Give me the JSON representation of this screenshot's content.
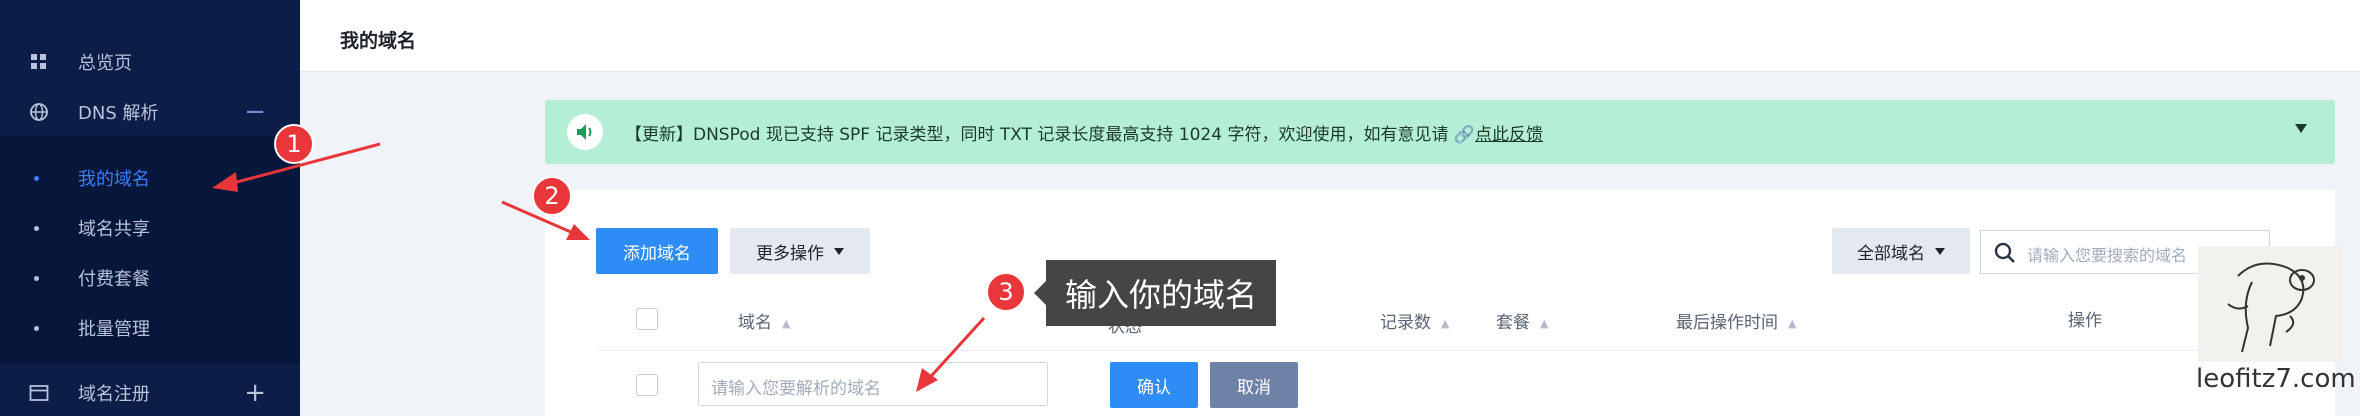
{
  "sidebar": {
    "items": [
      {
        "label": "总览页",
        "icon": "grid-icon"
      },
      {
        "label": "DNS 解析",
        "icon": "globe-icon",
        "toggle": "−"
      },
      {
        "label": "域名注册",
        "icon": "card-icon",
        "toggle": "+"
      }
    ],
    "dns_sub": [
      {
        "label": "我的域名",
        "active": true
      },
      {
        "label": "域名共享"
      },
      {
        "label": "付费套餐"
      },
      {
        "label": "批量管理"
      }
    ]
  },
  "header": {
    "title": "我的域名"
  },
  "notice": {
    "text": "【更新】DNSPod 现已支持 SPF 记录类型，同时 TXT 记录长度最高支持 1024 字符，欢迎使用，如有意见请 ",
    "link": "点此反馈",
    "bg": "#b4eed5"
  },
  "toolbar": {
    "add_label": "添加域名",
    "more_label": "更多操作",
    "filter_label": "全部域名",
    "search_placeholder": "请输入您要搜索的域名"
  },
  "table": {
    "columns": [
      "域名",
      "状态",
      "记录数",
      "套餐",
      "最后操作时间",
      "操作"
    ]
  },
  "new_row": {
    "placeholder": "请输入您要解析的域名",
    "confirm_label": "确认",
    "cancel_label": "取消"
  },
  "annotations": {
    "badges": [
      "1",
      "2",
      "3"
    ],
    "tooltip": "输入你的域名",
    "color": "#e8363a"
  },
  "watermark": {
    "text": "leofitz7.com"
  },
  "colors": {
    "primary": "#2d8cf6",
    "sidebar": "#0c1d48",
    "active": "#3d7df5"
  }
}
